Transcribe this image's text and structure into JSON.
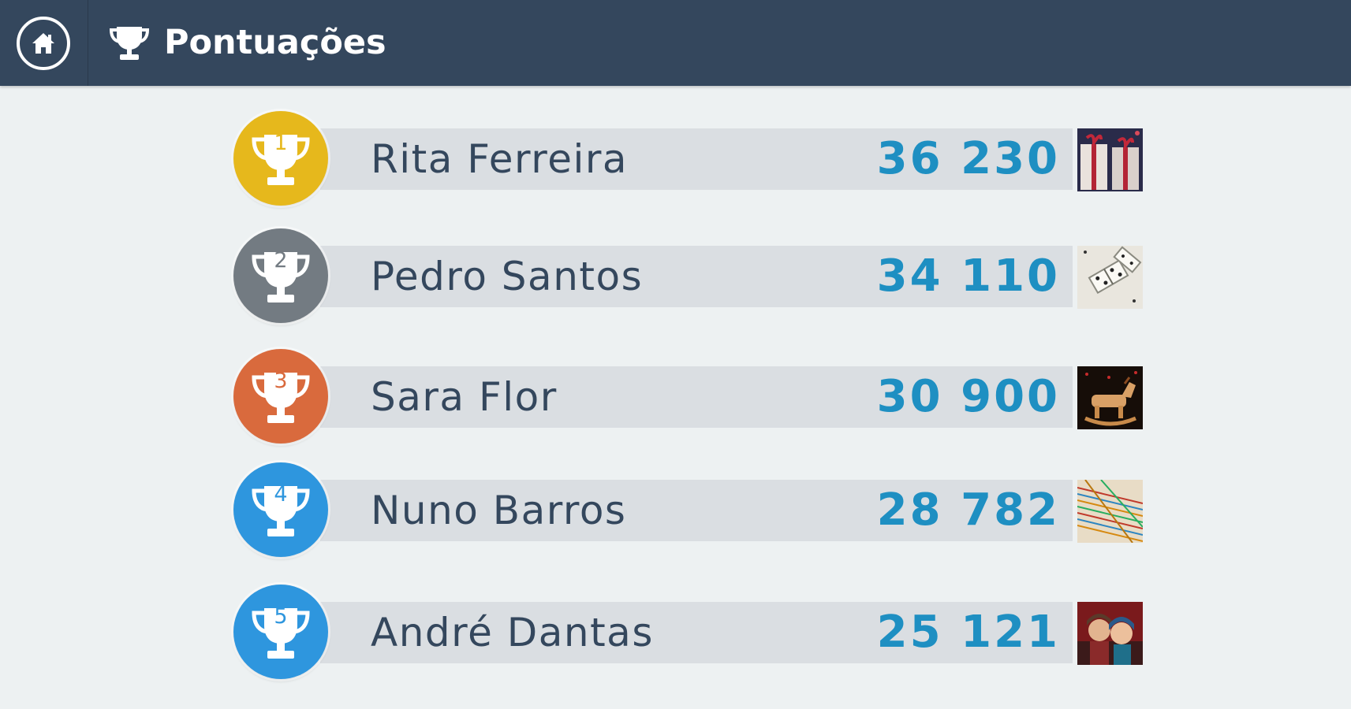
{
  "header": {
    "title": "Pontuações",
    "home_icon": "home-icon",
    "title_icon": "trophy-icon"
  },
  "colors": {
    "header_bg": "#34475d",
    "page_bg": "#edf1f2",
    "bar_bg": "#dadee2",
    "name_text": "#34475d",
    "score_text": "#1e8fc2",
    "gold": "#e6b81c",
    "silver": "#737b82",
    "bronze": "#d96a3d",
    "blue": "#2e96de"
  },
  "scores": [
    {
      "rank": "1",
      "name": "Rita Ferreira",
      "score": "36 230",
      "badge_color": "#e6b81c",
      "number_color": "#e6b81c",
      "thumbnail": "gift-boxes-photo"
    },
    {
      "rank": "2",
      "name": "Pedro Santos",
      "score": "34 110",
      "badge_color": "#737b82",
      "number_color": "#737b82",
      "thumbnail": "dominoes-photo"
    },
    {
      "rank": "3",
      "name": "Sara Flor",
      "score": "30 900",
      "badge_color": "#d96a3d",
      "number_color": "#d96a3d",
      "thumbnail": "rocking-horse-photo"
    },
    {
      "rank": "4",
      "name": "Nuno Barros",
      "score": "28 782",
      "badge_color": "#2e96de",
      "number_color": "#2e96de",
      "thumbnail": "mikado-sticks-photo"
    },
    {
      "rank": "5",
      "name": "André Dantas",
      "score": "25 121",
      "badge_color": "#2e96de",
      "number_color": "#2e96de",
      "thumbnail": "children-portrait-photo"
    }
  ]
}
